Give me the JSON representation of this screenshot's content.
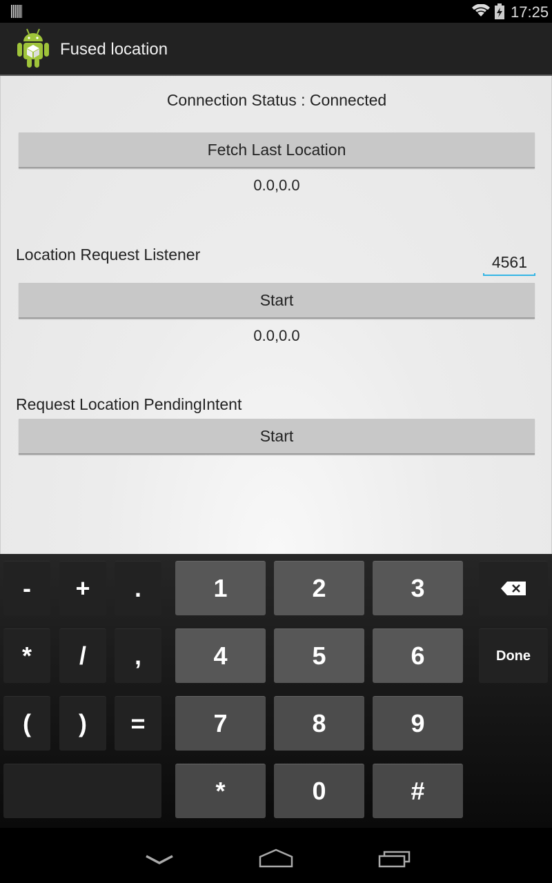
{
  "status_bar": {
    "time": "17:25",
    "icons": [
      "notification-bars-icon",
      "wifi-icon",
      "battery-charging-icon"
    ]
  },
  "action_bar": {
    "title": "Fused location",
    "icon": "android-app-icon"
  },
  "main": {
    "connection_status": "Connection Status : Connected",
    "fetch_last_location_label": "Fetch Last Location",
    "last_location_value": "0.0,0.0",
    "listener_section_label": "Location Request Listener",
    "interval_input_value": "4561",
    "listener_start_label": "Start",
    "listener_location_value": "0.0,0.0",
    "pending_intent_section_label": "Request Location PendingIntent",
    "pending_intent_start_label": "Start"
  },
  "keyboard": {
    "symbol_keys": [
      "-",
      "+",
      ".",
      "*",
      "/",
      ",",
      "(",
      ")",
      "="
    ],
    "number_keys": [
      "1",
      "2",
      "3",
      "4",
      "5",
      "6",
      "7",
      "8",
      "9",
      "*",
      "0",
      "#"
    ],
    "done_label": "Done",
    "backspace_icon": "backspace-icon"
  },
  "nav_bar": {
    "icons": [
      "back-chevron-icon",
      "home-icon",
      "recent-apps-icon"
    ]
  }
}
